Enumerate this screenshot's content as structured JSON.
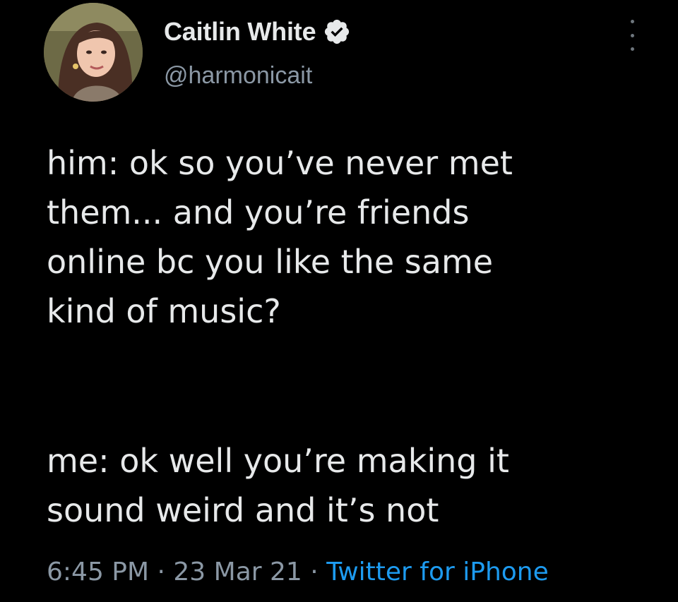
{
  "author": {
    "display_name": "Caitlin White",
    "handle": "@harmonicait",
    "verified_icon": "verified-badge-icon"
  },
  "tweet": {
    "paragraph_1": "him: ok so you’ve never met\nthem... and you’re friends\nonline bc you like the same\nkind of music?",
    "paragraph_2": "me: ok well you’re making it\nsound weird and it’s not"
  },
  "meta": {
    "time": "6:45 PM",
    "separator": " · ",
    "date": "23 Mar 21",
    "source": "Twitter for iPhone"
  },
  "colors": {
    "background": "#000000",
    "text": "#e7e9ea",
    "muted": "#8b98a5",
    "link": "#1d9bf0"
  }
}
